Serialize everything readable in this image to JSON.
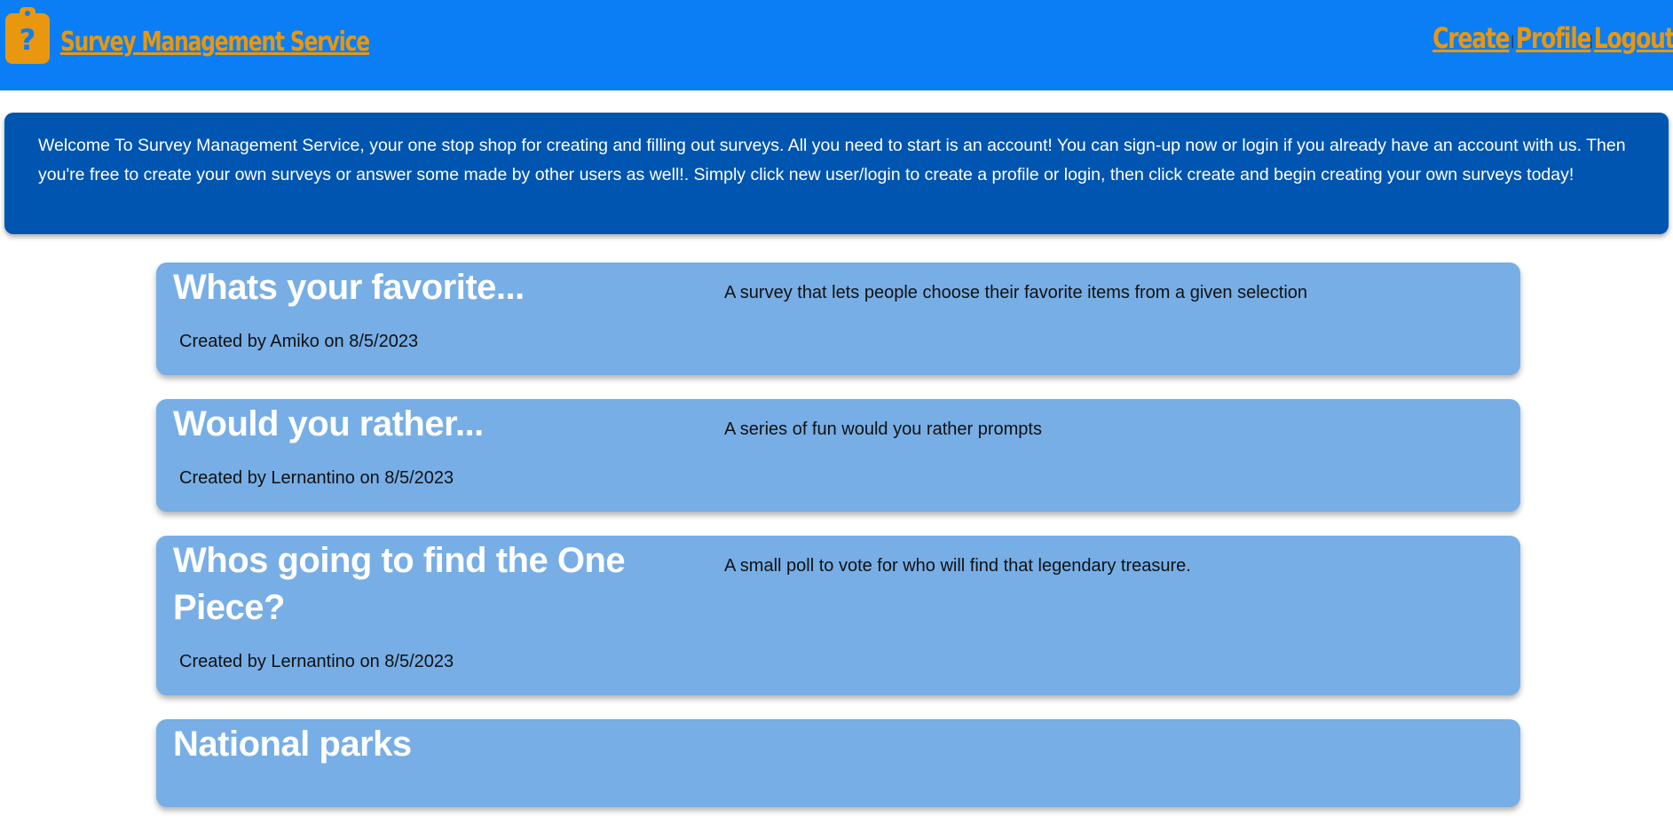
{
  "header": {
    "brand_icon": "clipboard-question-icon",
    "title": "Survey Management Service",
    "nav": {
      "create": "Create",
      "profile": "Profile",
      "logout": "Logout",
      "separator": "|"
    }
  },
  "welcome": {
    "text": "Welcome To Survey Management Service, your one stop shop for creating and filling out surveys. All you need to start is an account! You can sign-up now or login if you already have an account with us. Then you're free to create your own surveys or answer some made by other users as well!. Simply click new user/login to create a profile or login, then click create and begin creating your own surveys today!"
  },
  "surveys": [
    {
      "title": "Whats your favorite...",
      "description": "A survey that lets people choose their favorite items from a given selection",
      "meta": "Created by Amiko on 8/5/2023"
    },
    {
      "title": "Would you rather...",
      "description": "A series of fun would you rather prompts",
      "meta": "Created by Lernantino on 8/5/2023"
    },
    {
      "title": "Whos going to find the One Piece?",
      "description": "A small poll to vote for who will find that legendary treasure.",
      "meta": "Created by Lernantino on 8/5/2023"
    },
    {
      "title": "National parks",
      "description": "",
      "meta": ""
    }
  ],
  "colors": {
    "header_bg": "#0b7ef5",
    "brand_accent": "#e8970f",
    "welcome_bg": "#0055b0",
    "card_bg": "#77aee6"
  }
}
